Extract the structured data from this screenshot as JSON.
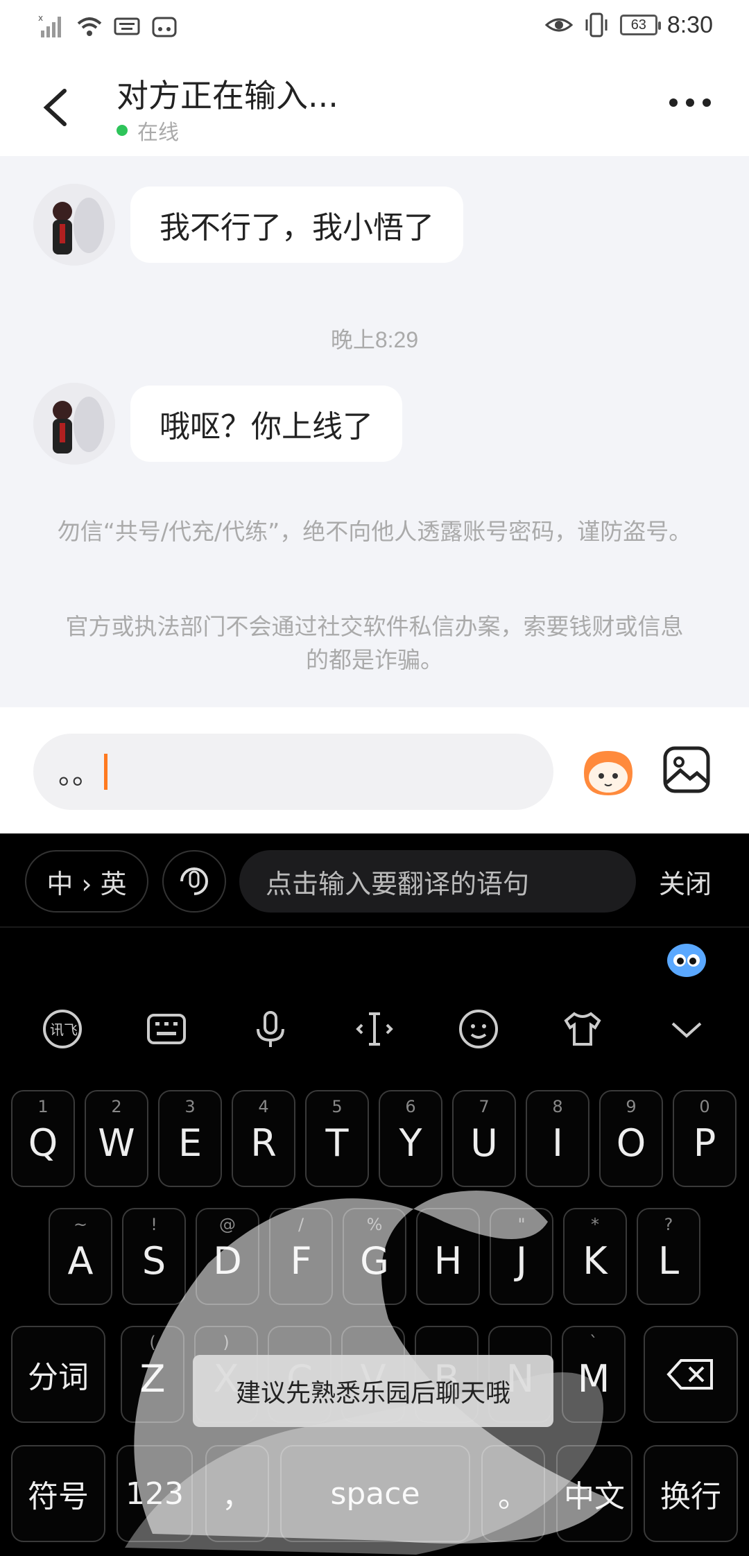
{
  "status_bar": {
    "time": "8:30",
    "battery": "63"
  },
  "header": {
    "title": "对方正在输入...",
    "status": "在线"
  },
  "messages": [
    {
      "text": "我不行了，我小悟了"
    },
    {
      "text": "哦呕？你上线了"
    }
  ],
  "timestamp": "晚上8:29",
  "notices": [
    "勿信“共号/代充/代练”，绝不向他人透露账号密码，谨防盗号。",
    "官方或执法部门不会通过社交软件私信办案，索要钱财或信息的都是诈骗。"
  ],
  "input": {
    "value": "。。"
  },
  "keyboard": {
    "translate_dir": "中 › 英",
    "translate_placeholder": "点击输入要翻译的语句",
    "close_label": "关闭",
    "row1": [
      {
        "sub": "1",
        "main": "Q"
      },
      {
        "sub": "2",
        "main": "W"
      },
      {
        "sub": "3",
        "main": "E"
      },
      {
        "sub": "4",
        "main": "R"
      },
      {
        "sub": "5",
        "main": "T"
      },
      {
        "sub": "6",
        "main": "Y"
      },
      {
        "sub": "7",
        "main": "U"
      },
      {
        "sub": "8",
        "main": "I"
      },
      {
        "sub": "9",
        "main": "O"
      },
      {
        "sub": "0",
        "main": "P"
      }
    ],
    "row2": [
      {
        "sub": "~",
        "main": "A"
      },
      {
        "sub": "!",
        "main": "S"
      },
      {
        "sub": "@",
        "main": "D"
      },
      {
        "sub": "/",
        "main": "F"
      },
      {
        "sub": "%",
        "main": "G"
      },
      {
        "sub": "",
        "main": "H"
      },
      {
        "sub": "\"",
        "main": "J"
      },
      {
        "sub": "*",
        "main": "K"
      },
      {
        "sub": "?",
        "main": "L"
      }
    ],
    "row3": [
      {
        "sub": "(",
        "main": "Z"
      },
      {
        "sub": ")",
        "main": "X"
      },
      {
        "sub": "",
        "main": "C"
      },
      {
        "sub": "",
        "main": "V"
      },
      {
        "sub": "",
        "main": "B"
      },
      {
        "sub": "",
        "main": "N"
      },
      {
        "sub": "`",
        "main": "M"
      }
    ],
    "fenci": "分词",
    "symbols": "符号",
    "num": "123",
    "comma": "，",
    "space": "space",
    "period": "。",
    "lang": "中文",
    "enter": "换行",
    "toast": "建议先熟悉乐园后聊天哦"
  }
}
